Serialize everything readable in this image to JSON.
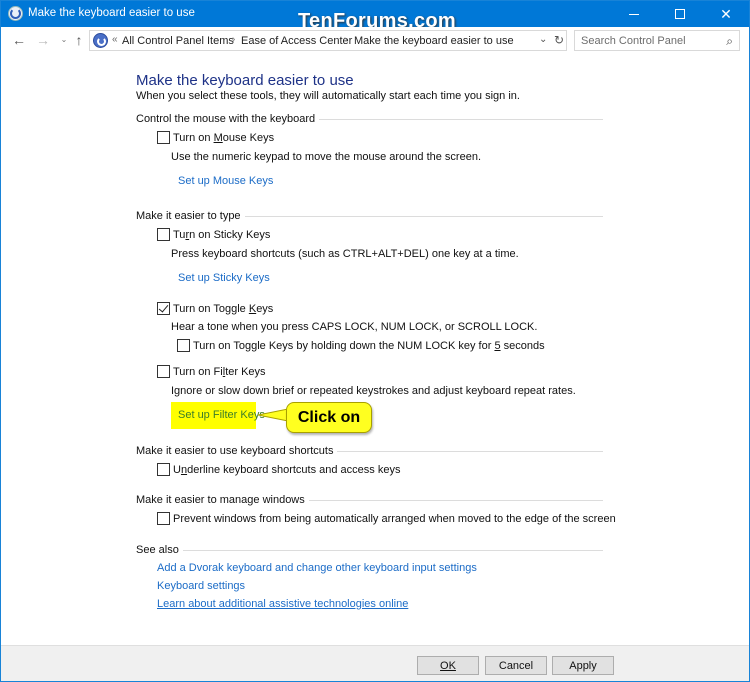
{
  "window": {
    "title": "Make the keyboard easier to use",
    "watermark": "TenForums.com",
    "controls": {
      "minimize": "—",
      "maximize": "☐",
      "close": "✕"
    }
  },
  "nav": {
    "back": "←",
    "forward": "→",
    "recent": "⌄",
    "up": "↑",
    "address_prefix": "«",
    "breadcrumb": [
      "All Control Panel Items",
      "Ease of Access Center",
      "Make the keyboard easier to use"
    ],
    "separator": "›",
    "dropdown": "⌄",
    "refresh": "↻",
    "search_placeholder": "Search Control Panel",
    "search_icon": "⌕"
  },
  "main": {
    "title": "Make the keyboard easier to use",
    "subtitle": "When you select these tools, they will automatically start each time you sign in.",
    "sections": {
      "mouse": {
        "heading": "Control the mouse with the keyboard",
        "mouse_keys": {
          "label_pre": "Turn on ",
          "label_u": "M",
          "label_post": "ouse Keys",
          "checked": false
        },
        "mouse_desc": "Use the numeric keypad to move the mouse around the screen.",
        "mouse_link": "Set up Mouse Keys"
      },
      "type": {
        "heading": "Make it easier to type",
        "sticky": {
          "label_pre": "Tu",
          "label_u": "r",
          "label_post": "n on Sticky Keys",
          "checked": false
        },
        "sticky_desc": "Press keyboard shortcuts (such as CTRL+ALT+DEL) one key at a time.",
        "sticky_link": "Set up Sticky Keys",
        "toggle": {
          "label_pre": "Turn on Toggle ",
          "label_u": "K",
          "label_post": "eys",
          "checked": true
        },
        "toggle_desc": "Hear a tone when you press CAPS LOCK, NUM LOCK, or SCROLL LOCK.",
        "toggle_hold": {
          "label_pre": "Turn on Toggle Keys by holding down the NUM LOCK key for ",
          "label_u": "5",
          "label_post": " seconds",
          "checked": false
        },
        "filter": {
          "label_pre": "Turn on Fi",
          "label_u": "l",
          "label_post": "ter Keys",
          "checked": false
        },
        "filter_desc": "Ignore or slow down brief or repeated keystrokes and adjust keyboard repeat rates.",
        "filter_link": "Set up Filter Keys"
      },
      "shortcuts": {
        "heading": "Make it easier to use keyboard shortcuts",
        "underline": {
          "label_pre": "U",
          "label_u": "n",
          "label_post": "derline keyboard shortcuts and access keys",
          "checked": false
        }
      },
      "windows": {
        "heading": "Make it easier to manage windows",
        "prevent": {
          "label": "Prevent windows from being automatically arranged when moved to the edge of the screen",
          "checked": false
        }
      },
      "see_also": {
        "heading": "See also",
        "links": [
          "Add a Dvorak keyboard and change other keyboard input settings",
          "Keyboard settings",
          "Learn about additional assistive technologies online"
        ]
      }
    },
    "callout": {
      "text": "Click on",
      "color": "#ffff00"
    }
  },
  "footer": {
    "ok": "OK",
    "cancel": "Cancel",
    "apply": "Apply"
  },
  "colors": {
    "titlebar": "#0078d7",
    "link": "#1c6cc7",
    "heading": "#1e3287",
    "highlight": "#ffff00"
  }
}
